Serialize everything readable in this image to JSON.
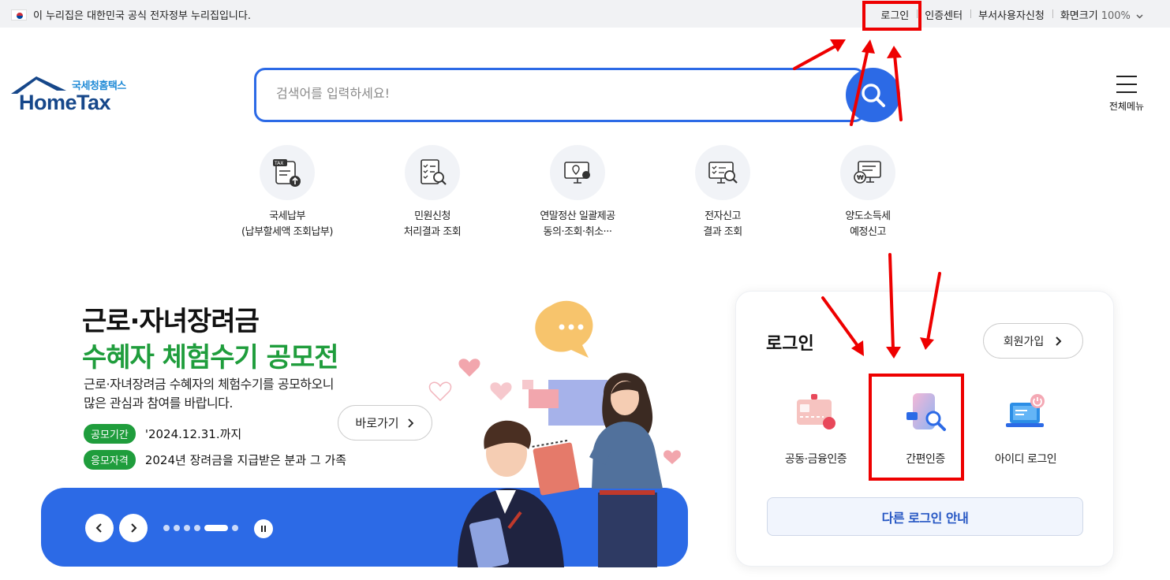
{
  "gov_bar": {
    "notice": "이 누리집은 대한민국 공식 전자정부 누리집입니다.",
    "links": [
      "로그인",
      "인증센터",
      "부서사용자신청"
    ],
    "zoom_label": "화면크기",
    "zoom_value": "100%"
  },
  "logo": {
    "sub": "국세청홈택스",
    "main": "HomeTax"
  },
  "search": {
    "placeholder": "검색어를 입력하세요!"
  },
  "menu": {
    "label": "전체메뉴"
  },
  "quick_menus": [
    {
      "line1": "국세납부",
      "line2": "(납부할세액 조회납부)"
    },
    {
      "line1": "민원신청",
      "line2": "처리결과 조회"
    },
    {
      "line1": "연말정산 일괄제공",
      "line2": "동의·조회·취소···"
    },
    {
      "line1": "전자신고",
      "line2": "결과 조회"
    },
    {
      "line1": "양도소득세",
      "line2": "예정신고"
    }
  ],
  "banner": {
    "title1": "근로·자녀장려금",
    "title2": "수혜자 체험수기 공모전",
    "desc1": "근로·자녀장려금 수혜자의 체험수기를 공모하오니",
    "desc2": "많은 관심과 참여를 바랍니다.",
    "period_label": "공모기간",
    "period_value": "'2024.12.31.까지",
    "eligibility_label": "응모자격",
    "eligibility_value": "2024년 장려금을 지급받은 분과 그 가족",
    "goto": "바로가기"
  },
  "login": {
    "title": "로그인",
    "join": "회원가입",
    "options": [
      "공동·금융인증",
      "간편인증",
      "아이디 로그인"
    ],
    "other": "다른 로그인 안내"
  },
  "colors": {
    "accent": "#2c6ae6",
    "green": "#1f9d3c",
    "annotation": "#ee0000"
  }
}
